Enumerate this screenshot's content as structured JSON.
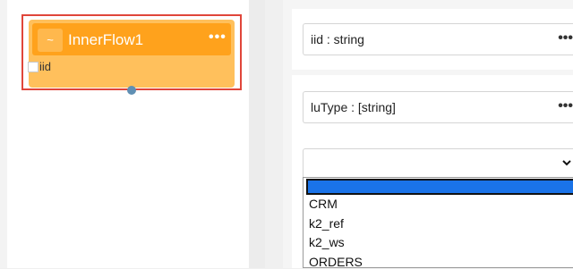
{
  "flow_node": {
    "tilde_icon": "~",
    "title": "InnerFlow1",
    "menu_icon": "•••",
    "ports": [
      {
        "label": "iid"
      }
    ]
  },
  "properties": {
    "fields": [
      {
        "label": "iid : string",
        "menu_icon": "•••"
      },
      {
        "label": "luType : [string]",
        "menu_icon": "•••"
      }
    ],
    "dropdown": {
      "selected_value": "",
      "options": [
        "",
        "CRM",
        "k2_ref",
        "k2_ws",
        "ORDERS"
      ]
    }
  },
  "colors": {
    "node_body": "#ffc05c",
    "node_header": "#ffa21c",
    "selection_frame": "#e0463a",
    "output_dot": "#5f8fb3",
    "highlight": "#1a73e8"
  }
}
